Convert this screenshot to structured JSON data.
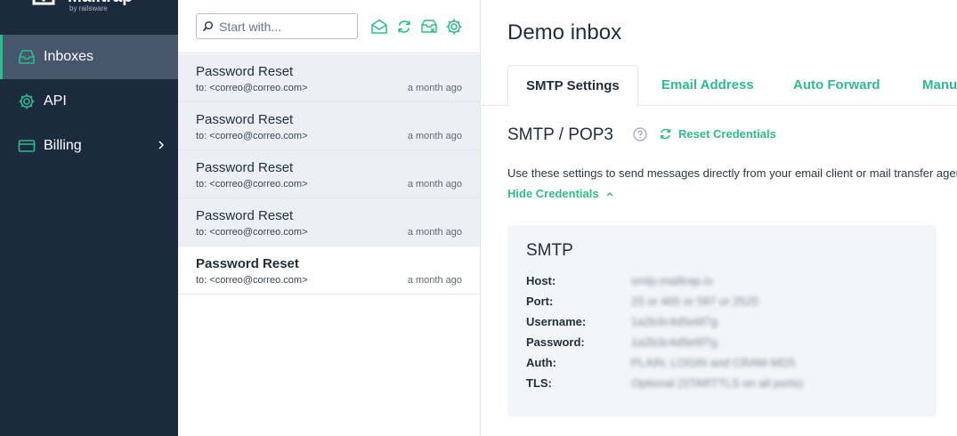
{
  "brand": {
    "name": "Mailtrap",
    "tagline": "by railsware"
  },
  "sidebar": {
    "items": [
      {
        "label": "Inboxes",
        "icon": "inbox-icon",
        "active": true
      },
      {
        "label": "API",
        "icon": "gear-icon",
        "active": false
      },
      {
        "label": "Billing",
        "icon": "credit-card-icon",
        "active": false
      }
    ]
  },
  "search": {
    "placeholder": "Start with..."
  },
  "toolbar_icons": [
    "mark-read-icon",
    "refresh-icon",
    "clear-inbox-icon",
    "settings-icon"
  ],
  "messages": [
    {
      "subject": "Password Reset",
      "to": "to: <correo@correo.com>",
      "time": "a month ago",
      "unread": false
    },
    {
      "subject": "Password Reset",
      "to": "to: <correo@correo.com>",
      "time": "a month ago",
      "unread": false
    },
    {
      "subject": "Password Reset",
      "to": "to: <correo@correo.com>",
      "time": "a month ago",
      "unread": false
    },
    {
      "subject": "Password Reset",
      "to": "to: <correo@correo.com>",
      "time": "a month ago",
      "unread": false
    },
    {
      "subject": "Password Reset",
      "to": "to: <correo@correo.com>",
      "time": "a month ago",
      "unread": true
    }
  ],
  "main": {
    "title": "Demo inbox",
    "tabs": [
      {
        "label": "SMTP Settings",
        "active": true
      },
      {
        "label": "Email Address",
        "active": false
      },
      {
        "label": "Auto Forward",
        "active": false
      },
      {
        "label": "Manual",
        "active": false
      }
    ],
    "section_title": "SMTP / POP3",
    "reset_label": "Reset Credentials",
    "description": "Use these settings to send messages directly from your email client or mail transfer agent.",
    "hide_label": "Hide Credentials",
    "panel": {
      "title": "SMTP",
      "rows": [
        {
          "label": "Host:",
          "value": "smtp.mailtrap.io"
        },
        {
          "label": "Port:",
          "value": "25 or 465 or 587 or 2525"
        },
        {
          "label": "Username:",
          "value": "1a2b3c4d5e6f7g"
        },
        {
          "label": "Password:",
          "value": "1a2b3c4d5e6f7g"
        },
        {
          "label": "Auth:",
          "value": "PLAIN, LOGIN and CRAM-MD5"
        },
        {
          "label": "TLS:",
          "value": "Optional (STARTTLS on all ports)"
        }
      ]
    }
  },
  "colors": {
    "sidebar_bg": "#1b2a3d",
    "accent": "#2ebc8f",
    "active_item_bg": "#47566b",
    "read_row_bg": "#ecf0f4"
  }
}
